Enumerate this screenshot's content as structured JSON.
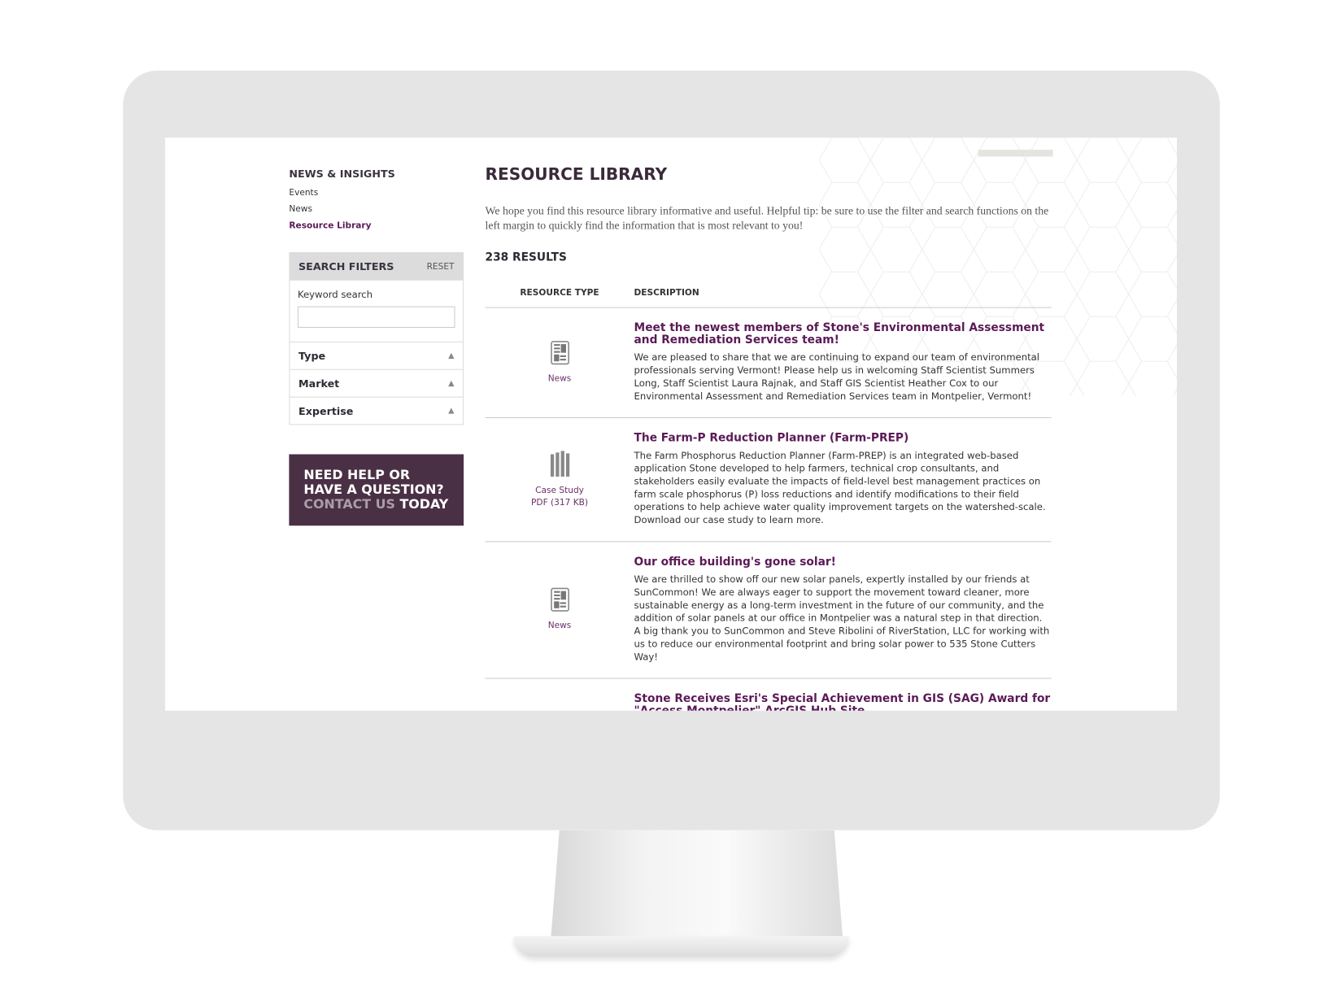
{
  "sidebar": {
    "heading": "NEWS & INSIGHTS",
    "links": [
      {
        "label": "Events"
      },
      {
        "label": "News"
      },
      {
        "label": "Resource Library",
        "active": true
      }
    ]
  },
  "filters": {
    "title": "SEARCH FILTERS",
    "reset": "RESET",
    "keyword_label": "Keyword search",
    "keyword_value": "",
    "facets": [
      "Type",
      "Market",
      "Expertise"
    ]
  },
  "help": {
    "line1": "NEED HELP OR",
    "line2": "HAVE A QUESTION?",
    "contact": "CONTACT US",
    "today": "TODAY"
  },
  "main": {
    "title": "RESOURCE LIBRARY",
    "intro": "We hope you find this resource library informative and useful.  Helpful tip: be sure to use the filter and search functions on the left margin to quickly find the information that is most relevant to you!",
    "count": "238 RESULTS",
    "columns": [
      "RESOURCE TYPE",
      "DESCRIPTION"
    ],
    "results": [
      {
        "type": "News",
        "icon": "newspaper-icon",
        "title": "Meet the newest members of Stone's Environmental Assessment and Remediation Services team!",
        "desc": "We are pleased to share that we are continuing to expand our team of environmental professionals serving Vermont! Please help us in welcoming Staff Scientist Summers Long, Staff Scientist Laura Rajnak, and Staff GIS Scientist Heather Cox to our Environmental Assessment and Remediation Services team in Montpelier, Vermont!"
      },
      {
        "type": "Case Study",
        "file": "PDF (317 KB)",
        "icon": "books-icon",
        "title": "The Farm-P Reduction Planner (Farm-PREP)",
        "desc": "The Farm Phosphorus Reduction Planner (Farm-PREP) is an integrated web-based application Stone developed to help farmers, technical crop consultants, and stakeholders easily evaluate the impacts of field-level best management practices on farm scale phosphorus (P) loss reductions and identify modifications to their field operations to help achieve water quality improvement targets on the watershed-scale. Download our case study to learn more."
      },
      {
        "type": "News",
        "icon": "newspaper-icon",
        "title": "Our office building's gone solar!",
        "desc": "We are thrilled to show off our new solar panels, expertly installed by our friends at SunCommon! We are always eager to support the movement toward cleaner, more sustainable energy as a long-term investment in the future of our community, and the addition of solar panels at our office in Montpelier was a natural step in that direction. A big thank you to SunCommon and Steve Ribolini of RiverStation, LLC for working with us to reduce our environmental footprint and bring solar power to 535 Stone Cutters Way!"
      },
      {
        "title": "Stone Receives Esri's Special Achievement in GIS (SAG) Award for \"Access Montpelier\" ArcGIS Hub Site"
      }
    ]
  },
  "colors": {
    "accent": "#5b1a57",
    "help_bg": "#4a3045",
    "bezel": "#e5e5e5"
  }
}
